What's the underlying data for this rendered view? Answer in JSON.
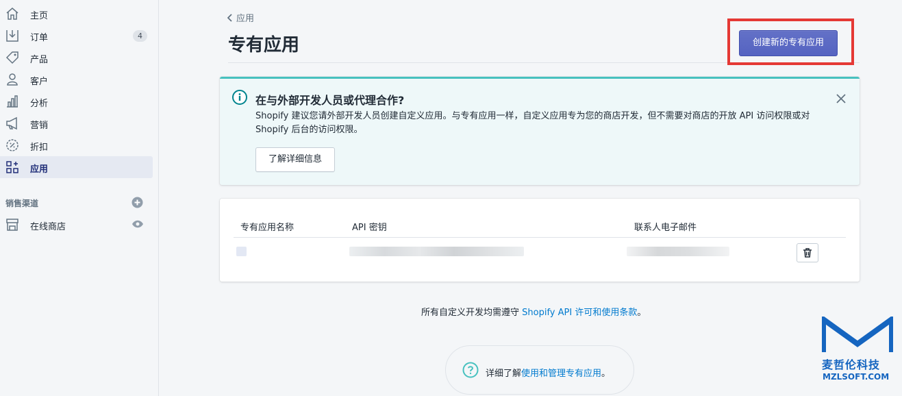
{
  "sidebar": {
    "items": [
      {
        "label": "主页"
      },
      {
        "label": "订单",
        "badge": "4"
      },
      {
        "label": "产品"
      },
      {
        "label": "客户"
      },
      {
        "label": "分析"
      },
      {
        "label": "营销"
      },
      {
        "label": "折扣"
      },
      {
        "label": "应用"
      }
    ],
    "section_title": "销售渠道",
    "channel": {
      "label": "在线商店"
    }
  },
  "header": {
    "breadcrumb": "应用",
    "title": "专有应用",
    "create_button": "创建新的专有应用"
  },
  "banner": {
    "title": "在与外部开发人员或代理合作?",
    "text": "Shopify 建议您请外部开发人员创建自定义应用。与专有应用一样，自定义应用专为您的商店开发，但不需要对商店的开放 API 访问权限或对 Shopify 后台的访问权限。",
    "button": "了解详细信息"
  },
  "table": {
    "columns": [
      "专有应用名称",
      "API 密钥",
      "联系人电子邮件"
    ]
  },
  "footer": {
    "text_before": "所有自定义开发均需遵守 ",
    "link": "Shopify API 许可和使用条款",
    "text_after": "。"
  },
  "help": {
    "text_before": "详细了解",
    "link": "使用和管理专有应用",
    "text_after": "。"
  },
  "watermark": {
    "name_cn": "麦哲伦科技",
    "name_en": "MZLSOFT.COM"
  },
  "colors": {
    "primary": "#5c6ac4",
    "teal": "#47c1bf",
    "link": "#007ace",
    "highlight": "#e53935",
    "watermark": "#1565c0"
  }
}
